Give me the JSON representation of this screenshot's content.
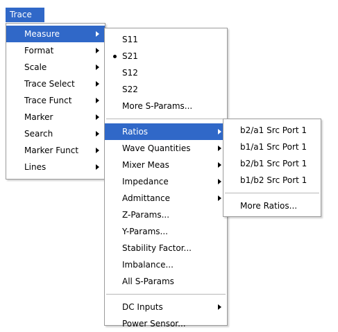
{
  "menubar": {
    "trace_label": "Trace"
  },
  "trace_menu": {
    "items": [
      {
        "label": "Measure"
      },
      {
        "label": "Format"
      },
      {
        "label": "Scale"
      },
      {
        "label": "Trace Select"
      },
      {
        "label": "Trace Funct"
      },
      {
        "label": "Marker"
      },
      {
        "label": "Search"
      },
      {
        "label": "Marker Funct"
      },
      {
        "label": "Lines"
      }
    ]
  },
  "measure_menu": {
    "group1": [
      {
        "label": "S11"
      },
      {
        "label": "S21"
      },
      {
        "label": "S12"
      },
      {
        "label": "S22"
      },
      {
        "label": "More S-Params..."
      }
    ],
    "group2": [
      {
        "label": "Ratios"
      },
      {
        "label": "Wave Quantities"
      },
      {
        "label": "Mixer Meas"
      },
      {
        "label": "Impedance"
      },
      {
        "label": "Admittance"
      },
      {
        "label": "Z-Params..."
      },
      {
        "label": "Y-Params..."
      },
      {
        "label": "Stability Factor..."
      },
      {
        "label": "Imbalance..."
      },
      {
        "label": "All S-Params"
      }
    ],
    "group3": [
      {
        "label": "DC Inputs"
      },
      {
        "label": "Power Sensor..."
      }
    ]
  },
  "ratios_menu": {
    "items": [
      {
        "label": "b2/a1 Src Port 1"
      },
      {
        "label": "b1/a1 Src Port 1"
      },
      {
        "label": "b2/b1 Src Port 1"
      },
      {
        "label": "b1/b2 Src Port 1"
      }
    ],
    "more": {
      "label": "More Ratios..."
    }
  }
}
